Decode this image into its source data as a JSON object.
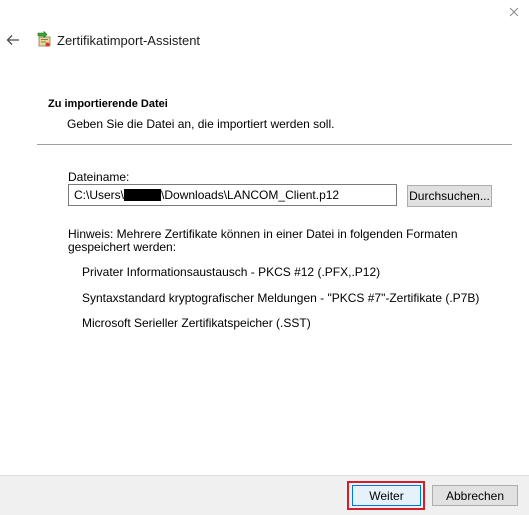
{
  "window": {
    "title": "Zertifikatimport-Assistent",
    "close_icon": "close-icon",
    "back_icon": "back-arrow-icon",
    "app_icon": "certificate-import-icon"
  },
  "section": {
    "heading": "Zu importierende Datei",
    "description": "Geben Sie die Datei an, die importiert werden soll."
  },
  "file": {
    "label": "Dateiname:",
    "path_prefix": "C:\\Users\\",
    "path_suffix": "\\Downloads\\LANCOM_Client.p12",
    "browse_label": "Durchsuchen..."
  },
  "hint": {
    "text": "Hinweis: Mehrere Zertifikate können in einer Datei in folgenden Formaten gespeichert werden:",
    "formats": [
      "Privater Informationsaustausch - PKCS #12 (.PFX,.P12)",
      "Syntaxstandard kryptografischer Meldungen - \"PKCS #7\"-Zertifikate (.P7B)",
      "Microsoft Serieller Zertifikatspeicher (.SST)"
    ]
  },
  "footer": {
    "next_label": "Weiter",
    "cancel_label": "Abbrechen",
    "highlight_color": "#d31f2a"
  }
}
